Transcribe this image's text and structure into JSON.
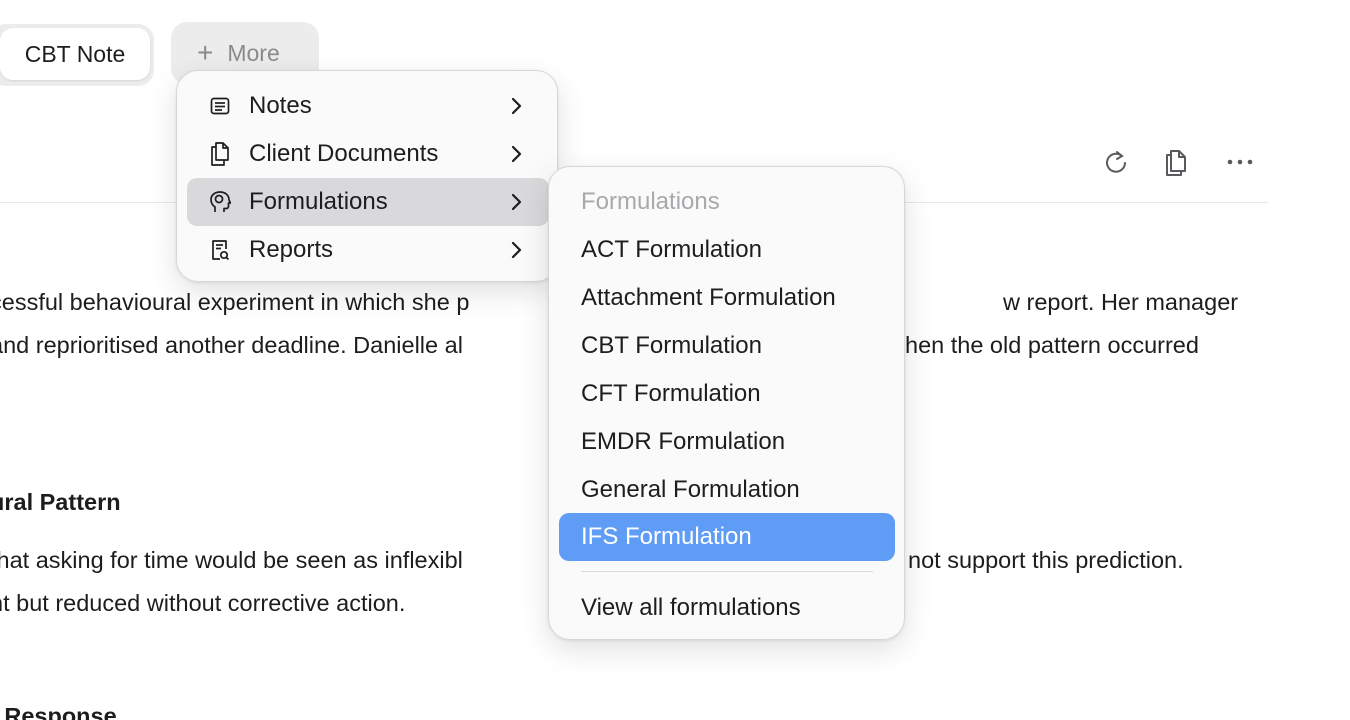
{
  "tabs": {
    "active_label": "CBT Note",
    "more_label": "More"
  },
  "toolbar": {
    "icons": [
      "refresh-icon",
      "copy-icon",
      "more-horizontal-icon"
    ]
  },
  "document": {
    "line1": "cessful behavioural experiment in which she p",
    "line1_end": "w report. Her manager",
    "line2": " and reprioritised another deadline. Danielle al",
    "line2_end": "hen the old pattern occurred",
    "heading1": "ural Pattern",
    "line3": "that asking for time would be seen as inflexibl",
    "line3_end": "not support this prediction.",
    "line4": "nt but reduced without corrective action.",
    "heading2": "t Response"
  },
  "main_menu": {
    "items": [
      {
        "label": "Notes",
        "icon": "notes-icon"
      },
      {
        "label": "Client Documents",
        "icon": "documents-icon"
      },
      {
        "label": "Formulations",
        "icon": "brain-head-icon"
      },
      {
        "label": "Reports",
        "icon": "report-search-icon"
      }
    ],
    "hovered_index": 2
  },
  "sub_menu": {
    "header": "Formulations",
    "items": [
      "ACT Formulation",
      "Attachment Formulation",
      "CBT Formulation",
      "CFT Formulation",
      "EMDR Formulation",
      "General Formulation",
      "IFS Formulation"
    ],
    "selected_index": 6,
    "footer": "View all formulations"
  },
  "colors": {
    "selected": "#5f9cf6",
    "hover": "#d9d9db",
    "muted_text": "#a9a9ad"
  }
}
